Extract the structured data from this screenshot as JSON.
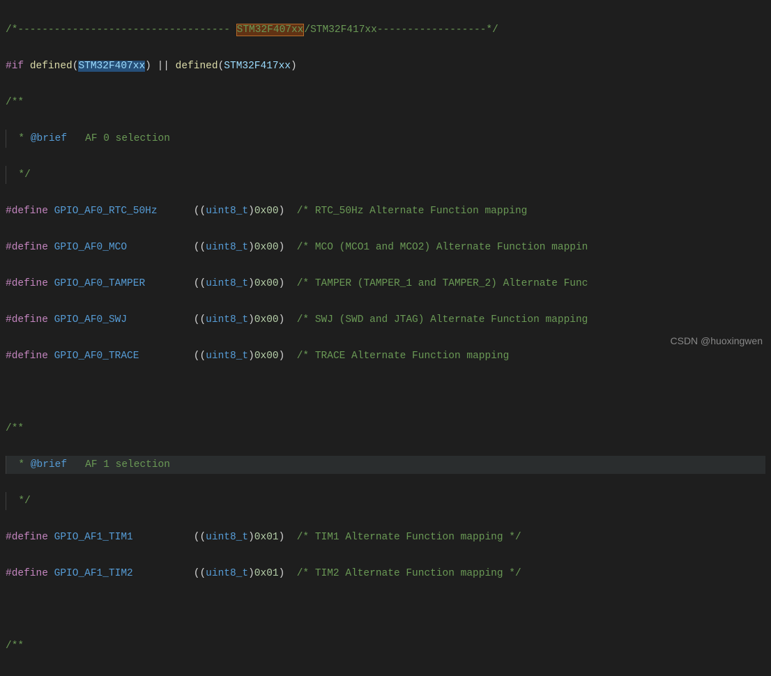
{
  "header_comment": {
    "prefix": "/*----------------------------------- ",
    "chip1": "STM32F407xx",
    "sep": "/",
    "chip2": "STM32F417xx",
    "suffix": "------------------*/"
  },
  "ifline": {
    "hash_if": "#if",
    "defined1": "defined",
    "arg1": "STM32F407xx",
    "pipes": "||",
    "defined2": "defined",
    "arg2": "STM32F417xx"
  },
  "doc1": {
    "open": "/**",
    "brief_star": "  * ",
    "brief_tag": "@brief",
    "brief_text": "   AF 0 selection",
    "close_star": "  */"
  },
  "defs_af0": [
    {
      "kw": "#define",
      "name": "GPIO_AF0_RTC_50Hz",
      "pad": "      ",
      "cast": "((uint8_t)",
      "val": "0x00",
      "close": ")",
      "cmt": "/* RTC_50Hz Alternate Function mapping"
    },
    {
      "kw": "#define",
      "name": "GPIO_AF0_MCO",
      "pad": "           ",
      "cast": "((uint8_t)",
      "val": "0x00",
      "close": ")",
      "cmt": "/* MCO (MCO1 and MCO2) Alternate Function mappin"
    },
    {
      "kw": "#define",
      "name": "GPIO_AF0_TAMPER",
      "pad": "        ",
      "cast": "((uint8_t)",
      "val": "0x00",
      "close": ")",
      "cmt": "/* TAMPER (TAMPER_1 and TAMPER_2) Alternate Func"
    },
    {
      "kw": "#define",
      "name": "GPIO_AF0_SWJ",
      "pad": "           ",
      "cast": "((uint8_t)",
      "val": "0x00",
      "close": ")",
      "cmt": "/* SWJ (SWD and JTAG) Alternate Function mapping"
    },
    {
      "kw": "#define",
      "name": "GPIO_AF0_TRACE",
      "pad": "         ",
      "cast": "((uint8_t)",
      "val": "0x00",
      "close": ")",
      "cmt": "/* TRACE Alternate Function mapping"
    }
  ],
  "doc2": {
    "open": "/**",
    "brief_star": "  * ",
    "brief_tag": "@brief",
    "brief_text": "   AF 1 selection",
    "close_star": "  */"
  },
  "defs_af1": [
    {
      "kw": "#define",
      "name": "GPIO_AF1_TIM1",
      "pad": "          ",
      "cast": "((uint8_t)",
      "val": "0x01",
      "close": ")",
      "cmt": "/* TIM1 Alternate Function mapping */"
    },
    {
      "kw": "#define",
      "name": "GPIO_AF1_TIM2",
      "pad": "          ",
      "cast": "((uint8_t)",
      "val": "0x01",
      "close": ")",
      "cmt": "/* TIM2 Alternate Function mapping */"
    }
  ],
  "doc3_open": "/**",
  "watermark": "CSDN @huoxingwen"
}
